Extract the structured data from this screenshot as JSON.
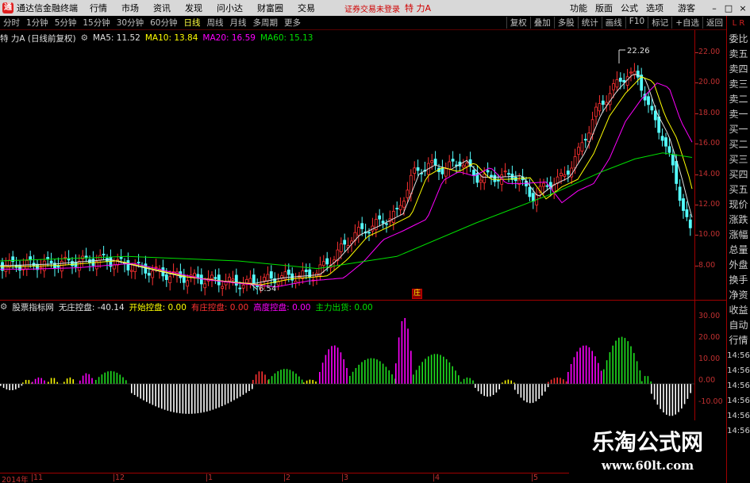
{
  "window": {
    "app_name": "通达信金融终端",
    "menus": [
      "行情",
      "市场",
      "资讯",
      "发现",
      "问小达",
      "财富圈",
      "交易"
    ],
    "warning": "证券交易未登录",
    "stock_name": "特 力A",
    "funcs": [
      "功能",
      "版面",
      "公式",
      "选项"
    ],
    "guest": "游客",
    "win_buttons": [
      "–",
      "□",
      "×"
    ]
  },
  "period_bar": {
    "periods": [
      "分时",
      "1分钟",
      "5分钟",
      "15分钟",
      "30分钟",
      "60分钟",
      "日线",
      "周线",
      "月线",
      "多周期",
      "更多"
    ],
    "active": "日线",
    "tools": [
      "复权",
      "叠加",
      "多股",
      "统计",
      "画线",
      "F10",
      "标记",
      "+自选",
      "返回"
    ]
  },
  "price_info": {
    "title": "特 力A (日线前复权)",
    "ma5": "MA5: 11.52",
    "ma10": "MA10: 13.84",
    "ma20": "MA20: 16.59",
    "ma60": "MA60: 15.13"
  },
  "indicator_info": {
    "name": "股票指标网",
    "v1": "无庄控盘: -40.14",
    "v2": "开始控盘: 0.00",
    "v3": "有庄控盘: 0.00",
    "v4": "高度控盘: 0.00",
    "v5": "主力出货: 0.00"
  },
  "annotations": {
    "high": "22.26",
    "low": "6.54",
    "marker": "庄"
  },
  "price_axis": [
    "22.00",
    "20.00",
    "18.00",
    "16.00",
    "14.00",
    "12.00",
    "10.00",
    "8.00"
  ],
  "indi_axis": [
    "30.00",
    "20.00",
    "10.00",
    "0.00",
    "-10.00"
  ],
  "time_axis": [
    "2014年",
    "11",
    "12",
    "1",
    "2",
    "3",
    "4",
    "5"
  ],
  "side_panel": {
    "header": "L R",
    "items": [
      "委比",
      "卖五",
      "卖四",
      "卖三",
      "卖二",
      "卖一",
      "买一",
      "买二",
      "买三",
      "买四",
      "买五",
      "现价",
      "涨跌",
      "涨幅",
      "总量",
      "外盘",
      "换手",
      "净资",
      "收益",
      "自动",
      "行情",
      "14:56",
      "14:56",
      "14:56",
      "14:56",
      "14:56",
      "14:56"
    ]
  },
  "colors": {
    "up": "#ff3232",
    "down": "#54ffff",
    "ma5": "#e0e0e0",
    "ma10": "#ffff00",
    "ma20": "#ff00ff",
    "ma60": "#00e000",
    "axis": "#c03030"
  },
  "watermark": {
    "title": "乐淘公式网",
    "url": "www.60lt.com"
  }
}
